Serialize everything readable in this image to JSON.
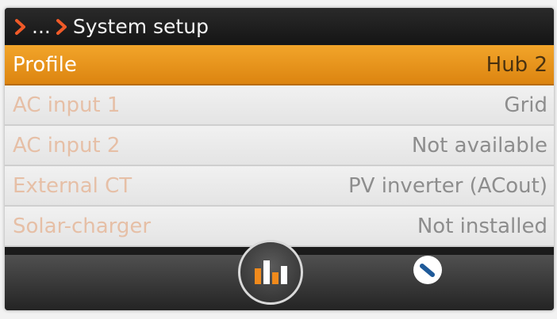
{
  "header": {
    "ellipsis": "...",
    "title": "System setup"
  },
  "rows": [
    {
      "label": "Profile",
      "value": "Hub 2",
      "selected": true
    },
    {
      "label": "AC input 1",
      "value": "Grid"
    },
    {
      "label": "AC input 2",
      "value": "Not available"
    },
    {
      "label": "External CT",
      "value": "PV inverter (ACout)"
    },
    {
      "label": "Solar-charger",
      "value": "Not installed"
    }
  ],
  "icons": {
    "breadcrumb": "chevron-right-icon",
    "chart_button": "bar-chart-icon",
    "menu_button": "slash-circle-icon"
  },
  "colors": {
    "accent": "#e8951c",
    "chevron": "#f05a28",
    "chart_bar_orange": "#f08a1c",
    "chart_bar_white": "#ffffff",
    "menu_slash": "#1f5a99"
  }
}
